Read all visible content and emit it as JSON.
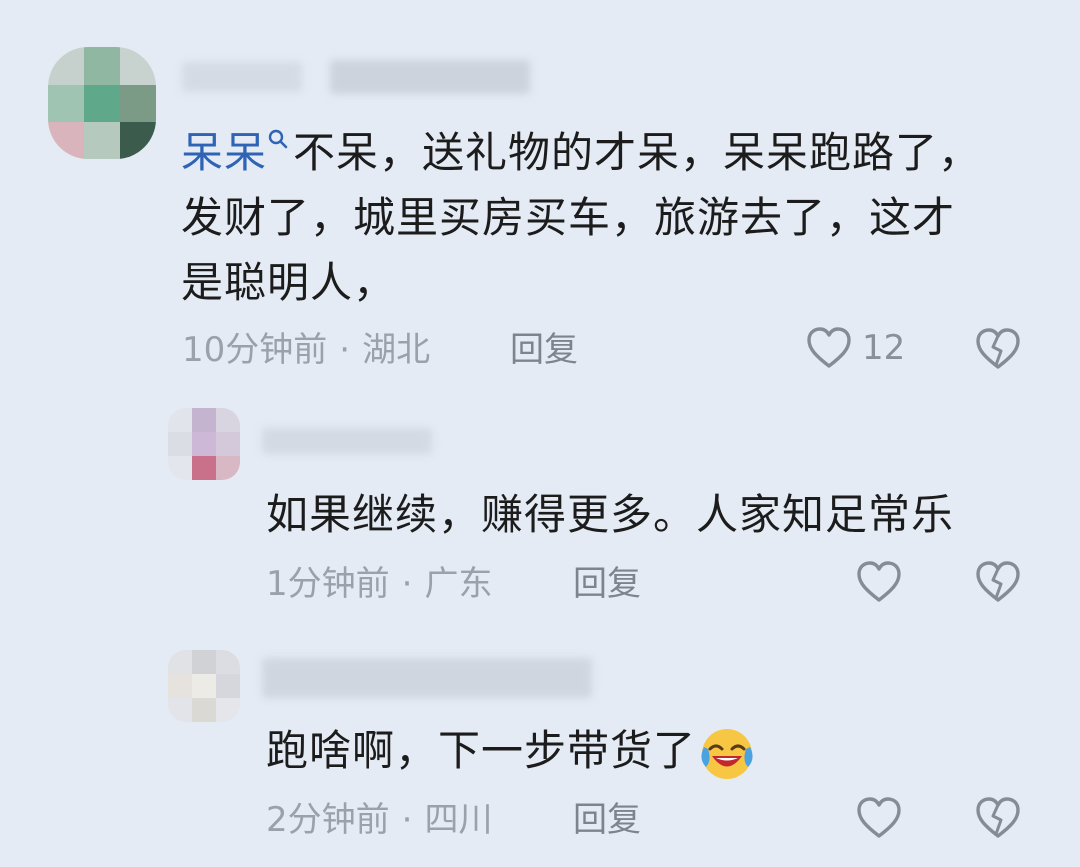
{
  "comments": [
    {
      "mention": "呆呆",
      "text": "不呆，送礼物的才呆，呆呆跑路了，\n发财了，城里买房买车，旅游去了，这才\n是聪明人，",
      "time": "10分钟前",
      "location": "湖北",
      "reply_label": "回复",
      "likes": "12"
    },
    {
      "text": "如果继续，赚得更多。人家知足常乐",
      "time": "1分钟前",
      "location": "广东",
      "reply_label": "回复"
    },
    {
      "text": "跑啥啊，下一步带货了",
      "time": "2分钟前",
      "location": "四川",
      "reply_label": "回复"
    }
  ],
  "icons": {
    "like": "heart-outline-icon",
    "dislike": "broken-heart-icon",
    "emoji": "crying-laughing-emoji",
    "mention": "search-icon"
  },
  "colors": {
    "background": "#e4ebf4",
    "mention": "#2f63b5",
    "meta": "#9aa1ab"
  }
}
